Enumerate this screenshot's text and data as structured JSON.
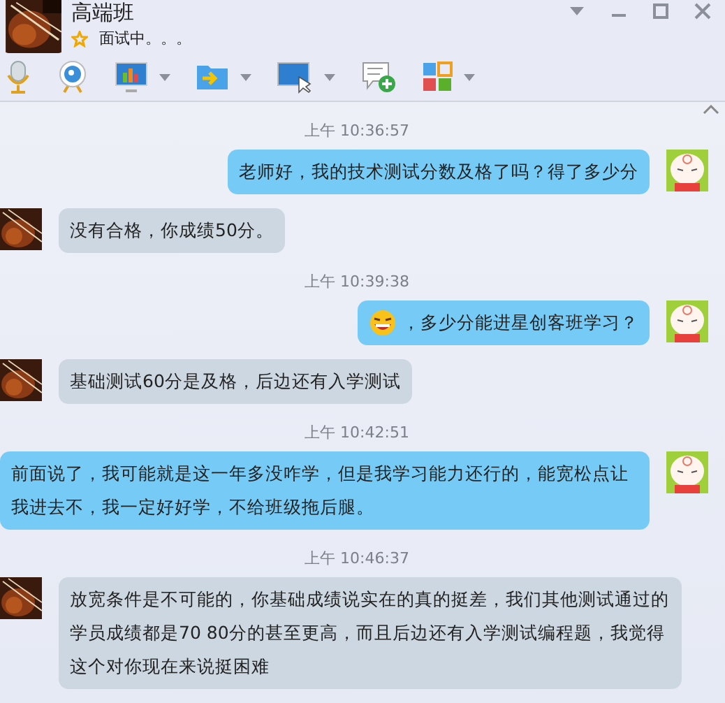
{
  "header": {
    "title": "高端班",
    "status": "面试中。。。"
  },
  "toolbar": [
    {
      "kind": "mic",
      "dropdown": false
    },
    {
      "kind": "webcam",
      "dropdown": false
    },
    {
      "kind": "chart",
      "dropdown": true
    },
    {
      "kind": "folder",
      "dropdown": true
    },
    {
      "kind": "screen",
      "dropdown": true
    },
    {
      "kind": "chat",
      "dropdown": false
    },
    {
      "kind": "apps",
      "dropdown": true
    }
  ],
  "messages": [
    {
      "kind": "time",
      "text": "上午 10:36:57"
    },
    {
      "kind": "sent",
      "text": "老师好，我的技术测试分数及格了吗？得了多少分",
      "emoji": false
    },
    {
      "kind": "received",
      "text": "没有合格，你成绩50分。"
    },
    {
      "kind": "time",
      "text": "上午 10:39:38"
    },
    {
      "kind": "sent",
      "text": "，多少分能进星创客班学习？",
      "emoji": true
    },
    {
      "kind": "received",
      "text": "基础测试60分是及格，后边还有入学测试"
    },
    {
      "kind": "time",
      "text": "上午 10:42:51"
    },
    {
      "kind": "sent",
      "text": "前面说了，我可能就是这一年多没咋学，但是我学习能力还行的，能宽松点让我进去不，我一定好好学，不给班级拖后腿。",
      "emoji": false
    },
    {
      "kind": "time",
      "text": "上午 10:46:37"
    },
    {
      "kind": "received",
      "text": "放宽条件是不可能的，你基础成绩说实在的真的挺差，我们其他测试通过的学员成绩都是70 80分的甚至更高，而且后边还有入学测试编程题，我觉得这个对你现在来说挺困难"
    }
  ]
}
